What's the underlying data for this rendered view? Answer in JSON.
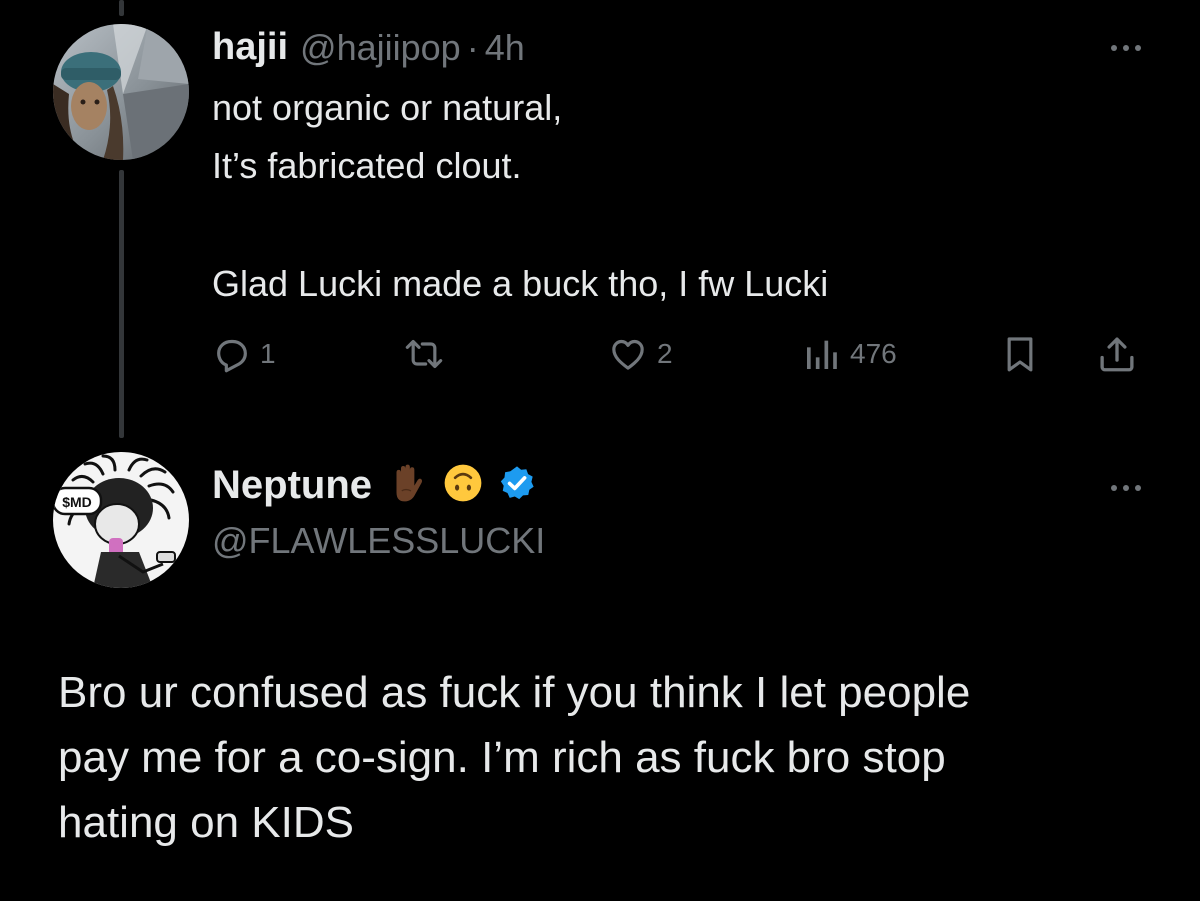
{
  "parent_tweet": {
    "display_name": "hajii",
    "handle": "@hajiipop",
    "separator": "·",
    "time": "4h",
    "text_lines": [
      "not organic or natural,",
      "It’s fabricated clout.",
      "Glad Lucki made a buck tho, I fw Lucki"
    ],
    "actions": {
      "reply_count": "1",
      "retweet_count": "",
      "like_count": "2",
      "view_count": "476"
    },
    "avatar_icon": "avatar-photo"
  },
  "reply_tweet": {
    "display_name": "Neptune",
    "handle": "@FLAWLESSLUCKI",
    "emojis": [
      "raised-hand-dark-skin-emoji",
      "upside-down-face-emoji"
    ],
    "verified_badge_color": "#1d9bf0",
    "avatar_label": "$MD",
    "text_lines": [
      "Bro ur confused as fuck if you think I let people",
      "pay me for a co-sign. I’m rich as fuck bro stop",
      "hating on KIDS"
    ]
  },
  "colors": {
    "background": "#000000",
    "primary_text": "#e7e9ea",
    "secondary_text": "#71767b",
    "thread_line": "#333639",
    "verified": "#1d9bf0"
  }
}
